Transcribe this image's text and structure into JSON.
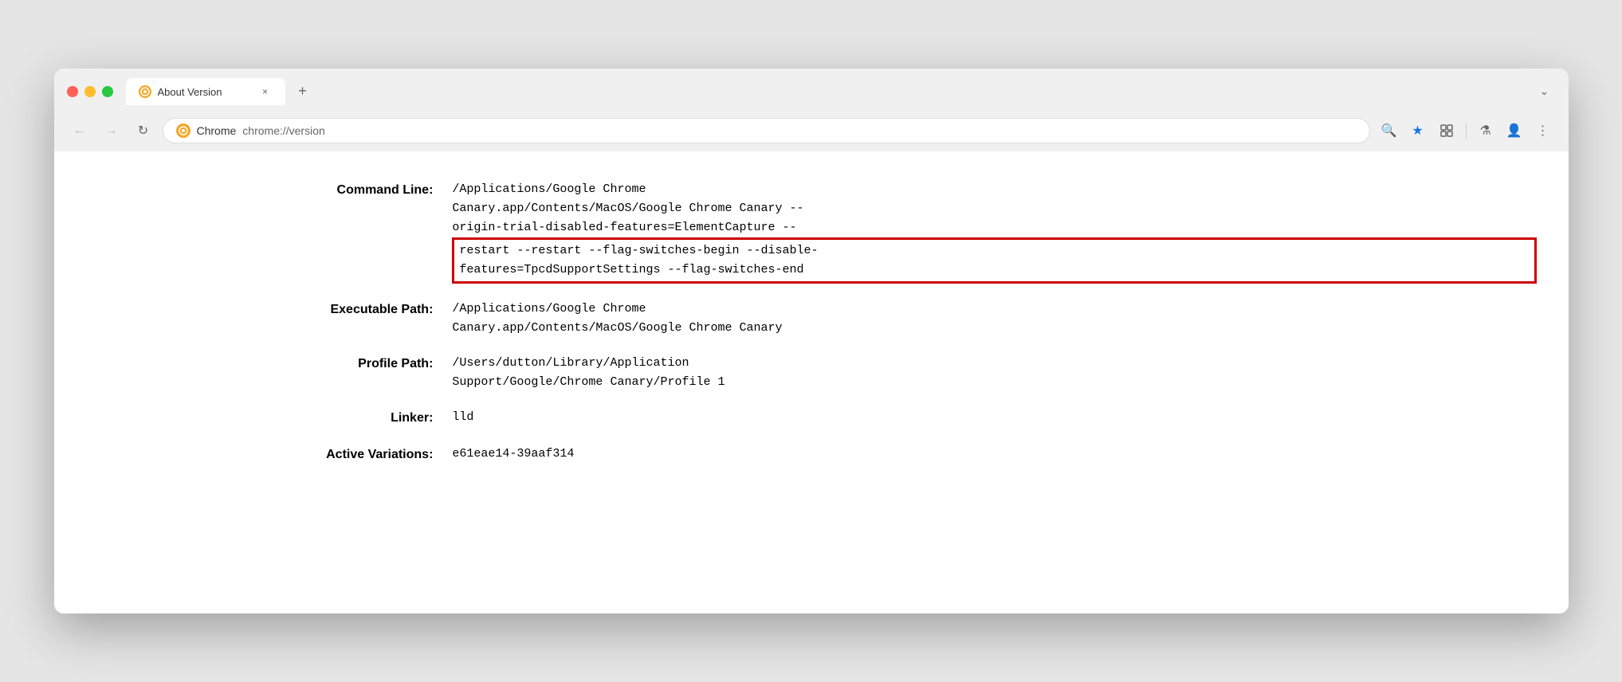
{
  "window": {
    "title": "About Version"
  },
  "tab": {
    "title": "About Version",
    "close_label": "×"
  },
  "new_tab_label": "+",
  "tab_list_label": "⌄",
  "nav": {
    "back_label": "←",
    "forward_label": "→",
    "reload_label": "↻"
  },
  "url_bar": {
    "site_name": "Chrome",
    "path": "chrome://version"
  },
  "toolbar": {
    "zoom_icon": "🔍",
    "bookmark_icon": "★",
    "extension_icon": "⬚",
    "lab_icon": "⚗",
    "profile_icon": "👤",
    "menu_icon": "⋮"
  },
  "page": {
    "rows": [
      {
        "label": "Command Line:",
        "value_lines": [
          "/Applications/Google Chrome",
          "Canary.app/Contents/MacOS/Google Chrome Canary --",
          "origin-trial-disabled-features=ElementCapture --"
        ],
        "highlighted_lines": [
          "restart --restart --flag-switches-begin --disable-",
          "features=TpcdSupportSettings --flag-switches-end"
        ]
      },
      {
        "label": "Executable Path:",
        "value_lines": [
          "/Applications/Google Chrome",
          "Canary.app/Contents/MacOS/Google Chrome Canary"
        ]
      },
      {
        "label": "Profile Path:",
        "value_lines": [
          "/Users/dutton/Library/Application",
          "Support/Google/Chrome Canary/Profile 1"
        ]
      },
      {
        "label": "Linker:",
        "value_lines": [
          "lld"
        ]
      },
      {
        "label": "Active Variations:",
        "value_lines": [
          "e61eae14-39aaf314"
        ]
      }
    ]
  }
}
